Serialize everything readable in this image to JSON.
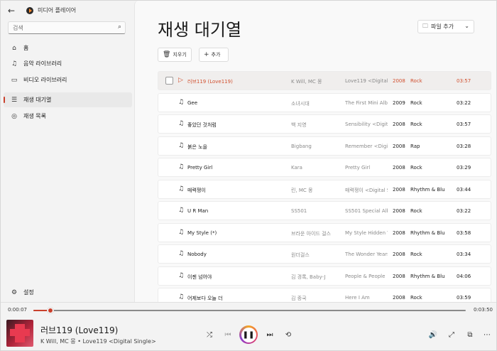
{
  "app": {
    "title": "미디어 플레이어"
  },
  "sidebar": {
    "search_placeholder": "검색",
    "items": [
      {
        "label": "홈",
        "icon": "home-icon"
      },
      {
        "label": "음악 라이브러리",
        "icon": "music-note-icon"
      },
      {
        "label": "비디오 라이브러리",
        "icon": "video-icon"
      },
      {
        "label": "재생 대기열",
        "icon": "queue-icon",
        "active": true
      },
      {
        "label": "재생 목록",
        "icon": "playlist-icon"
      }
    ],
    "settings_label": "설정"
  },
  "main": {
    "title": "재생 대기열",
    "add_file_label": "파일 추가",
    "clear_label": "지우기",
    "add_label": "추가",
    "tracks": [
      {
        "title": "러브119 (Love119)",
        "artist": "K Will, MC 몽",
        "album": "Love119 <Digital Single>",
        "year": "2008",
        "genre": "Rock",
        "duration": "03:57",
        "playing": true
      },
      {
        "title": "Gee",
        "artist": "소녀시대",
        "album": "The First Mini Album",
        "year": "2009",
        "genre": "Rock",
        "duration": "03:22"
      },
      {
        "title": "좋았던 것처럼",
        "artist": "백 지영",
        "album": "Sensibility <Digital Single>",
        "year": "2008",
        "genre": "Rock",
        "duration": "03:57"
      },
      {
        "title": "붉은 노을",
        "artist": "Bigbang",
        "album": "Remember <Digital>",
        "year": "2008",
        "genre": "Rap",
        "duration": "03:28"
      },
      {
        "title": "Pretty Girl",
        "artist": "Kara",
        "album": "Pretty Girl",
        "year": "2008",
        "genre": "Rock",
        "duration": "03:29"
      },
      {
        "title": "매력쟁이",
        "artist": "린, MC 몽",
        "album": "매력쟁이 <Digital Single>",
        "year": "2008",
        "genre": "Rhythm & Blues",
        "duration": "03:44"
      },
      {
        "title": "U R Man",
        "artist": "SS501",
        "album": "SS501 Special Album",
        "year": "2008",
        "genre": "Rock",
        "duration": "03:22"
      },
      {
        "title": "My Style (*)",
        "artist": "브라운 아이드 걸스",
        "album": "My Style Hidden Track",
        "year": "2008",
        "genre": "Rhythm & Blues",
        "duration": "03:58"
      },
      {
        "title": "Nobody",
        "artist": "원더걸스",
        "album": "The Wonder Years",
        "year": "2008",
        "genre": "Rock",
        "duration": "03:34"
      },
      {
        "title": "이젠 넘어야",
        "artist": "김 경록, Baby-J",
        "album": "People & People",
        "year": "2008",
        "genre": "Rhythm & Blues",
        "duration": "04:06"
      },
      {
        "title": "어제보다 오늘 더",
        "artist": "김 종국",
        "album": "Here I Am",
        "year": "2008",
        "genre": "Rock",
        "duration": "03:59"
      }
    ]
  },
  "player": {
    "current_time": "0:00:07",
    "total_time": "0:03:50",
    "progress": 0.04,
    "now_playing_title": "러브119 (Love119)",
    "now_playing_sub": "K Will, MC 몽 • Love119 <Digital Single>"
  },
  "colors": {
    "accent": "#c9402c",
    "playing_text": "#d1502f"
  }
}
